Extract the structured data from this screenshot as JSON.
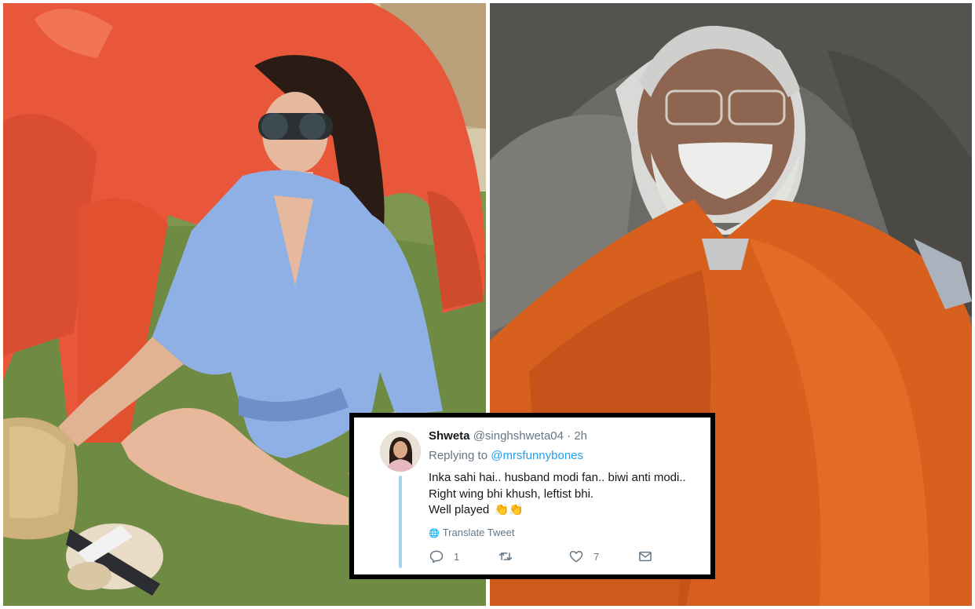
{
  "tweet": {
    "author_name": "Shweta",
    "author_handle": "@singhshweta04",
    "separator": "·",
    "time": "2h",
    "replying_prefix": "Replying to",
    "replying_to": "@mrsfunnybones",
    "text_lines": [
      "Inka sahi hai.. husband modi fan.. biwi anti modi..",
      "Right wing bhi khush, leftist bhi.",
      "Well played"
    ],
    "emoji": "👏👏",
    "translate_label": "Translate Tweet",
    "reply_count": "1",
    "retweet_count": "",
    "like_count": "7"
  },
  "icons": {
    "avatar": "user-avatar",
    "globe": "globe-icon",
    "reply": "reply-icon",
    "retweet": "retweet-icon",
    "like": "heart-icon",
    "dm": "envelope-icon"
  },
  "colors": {
    "link_blue": "#1da1f2",
    "muted_gray": "#657786",
    "text_dark": "#14171a",
    "thread_line": "#a9d4f0"
  }
}
